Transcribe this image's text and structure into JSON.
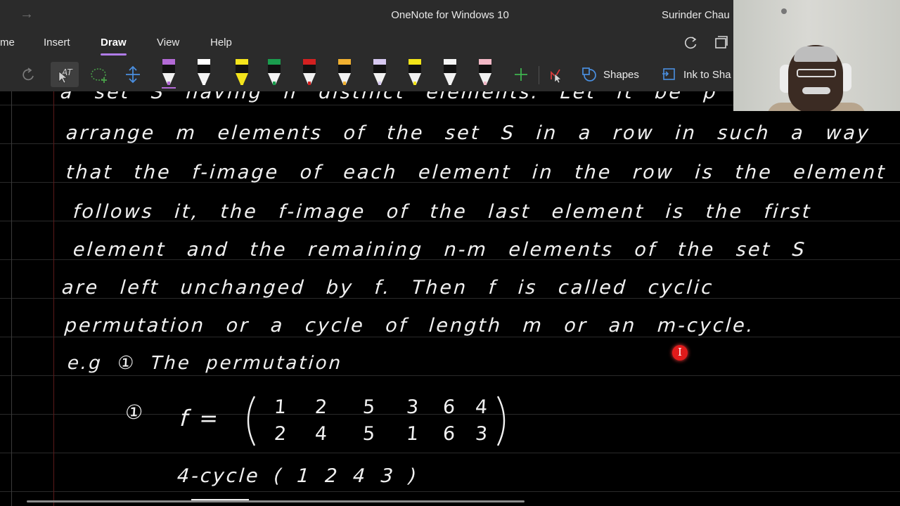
{
  "titlebar": {
    "back_glyph": "→",
    "app_title": "OneNote for Windows 10",
    "user_name": "Surinder Chau"
  },
  "menu": {
    "tabs": [
      "me",
      "Insert",
      "Draw",
      "View",
      "Help"
    ],
    "active_tab": "Draw"
  },
  "ribbon": {
    "tools": [
      "undo-icon",
      "lasso-select-icon",
      "add-space-icon",
      "insert-space-icon"
    ],
    "pens": [
      {
        "name": "pen-purple",
        "color": "#b36ad6"
      },
      {
        "name": "pen-white",
        "color": "#ffffff"
      },
      {
        "name": "highlighter-yellow",
        "color": "#f4e41c"
      },
      {
        "name": "pen-green",
        "color": "#1a9d4e"
      },
      {
        "name": "pen-red",
        "color": "#d32020"
      },
      {
        "name": "pen-orange",
        "color": "#f0b030"
      },
      {
        "name": "pen-lavender",
        "color": "#d6c8f0"
      },
      {
        "name": "pen-yellow",
        "color": "#f2e418"
      },
      {
        "name": "pen-white-2",
        "color": "#f4f4f4"
      },
      {
        "name": "pen-pink",
        "color": "#f2b8c6"
      }
    ],
    "shapes_label": "Shapes",
    "ink_to_shape_label": "Ink to Sha"
  },
  "notes": {
    "line0": "a set S having n distinct elements. Let it be p",
    "line1": "arrange m elements of the set S in a row in such a way",
    "line2": "that the f-image of each element in the row is the element",
    "line3": "follows it, the f-image of the last element is the first",
    "line4": "element and the remaining n-m elements of the set S",
    "line5": "are left unchanged by f. Then f is called cyclic",
    "line6": "permutation or a cycle of length m or an m-cycle.",
    "line7": "e.g ① The permutation",
    "example_label": "①",
    "f_eq": "f =",
    "matrix_top": [
      "1",
      "2",
      "5",
      "3",
      "6",
      "4"
    ],
    "matrix_bottom": [
      "2",
      "4",
      "5",
      "1",
      "6",
      "3"
    ],
    "cycle_line": "4-cycle  ( 1  2  4  3 )"
  },
  "colors": {
    "chrome": "#2b2b2b",
    "accent": "#b07ce8",
    "canvas": "#000000",
    "ink": "#f1f1f1",
    "cursor": "#e01b1b"
  }
}
